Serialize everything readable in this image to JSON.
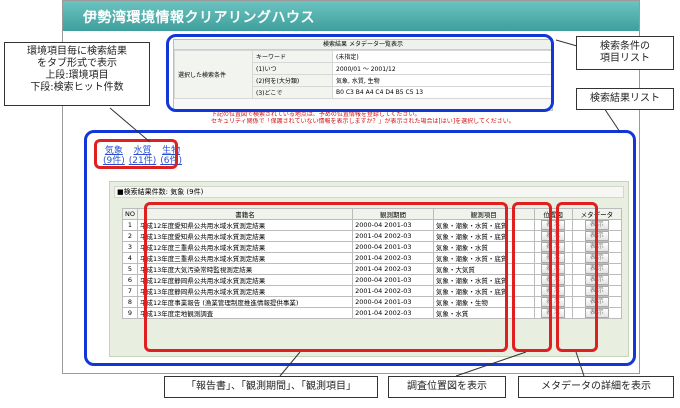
{
  "site": {
    "title": "伊勢湾環境情報クリアリングハウス"
  },
  "conditions": {
    "title": "検索結果 メタデータ一覧表示",
    "group_label": "選択した検索条件",
    "rows": [
      {
        "label": "キーワード",
        "value": "(未指定)"
      },
      {
        "label": "(1)いつ",
        "value": "2000/01 〜 2001/12"
      },
      {
        "label": "(2)何を(大分類)",
        "value": "気象, 水質, 生物"
      },
      {
        "label": "(3)どこで",
        "value": "B0 C3 B4 A4 C4 D4 B5 C5 13"
      }
    ]
  },
  "notice": {
    "line1": "下記の位置図で検索されている地点は、予めの位置情報を登録してください。",
    "line2": "セキュリティ関係で「保護されていない情報を表示しますか？」が表示された場合は[はい]を選択してください。"
  },
  "tabs": [
    {
      "label": "気象",
      "count": "(9件)"
    },
    {
      "label": "水質",
      "count": "(21件)"
    },
    {
      "label": "生物",
      "count": "(6件)"
    }
  ],
  "results": {
    "summary": "■検索結果件数: 気象 (9件)",
    "columns": [
      "NO",
      "書籍名",
      "観測期間",
      "観測項目",
      "位置図",
      "メタデータ"
    ],
    "button_label": "表 示",
    "rows": [
      {
        "no": "1",
        "name": "平成12年度愛知県公共用水域水質測定結果",
        "period": "2000-04 2001-03",
        "items": "気象・潮象・水質・底質"
      },
      {
        "no": "2",
        "name": "平成13年度愛知県公共用水域水質測定結果",
        "period": "2001-04 2002-03",
        "items": "気象・潮象・水質・底質"
      },
      {
        "no": "3",
        "name": "平成12年度三重県公共用水域水質測定結果",
        "period": "2000-04 2001-03",
        "items": "気象・潮象・水質"
      },
      {
        "no": "4",
        "name": "平成13年度三重県公共用水域水質測定結果",
        "period": "2001-04 2002-03",
        "items": "気象・潮象・水質・底質"
      },
      {
        "no": "5",
        "name": "平成13年度大気汚染常時監視測定結果",
        "period": "2001-04 2002-03",
        "items": "気象・大気質"
      },
      {
        "no": "6",
        "name": "平成12年度静岡県公共用水域水質測定結果",
        "period": "2000-04 2001-03",
        "items": "気象・潮象・水質・底質"
      },
      {
        "no": "7",
        "name": "平成13年度静岡県公共用水域水質測定結果",
        "period": "2001-04 2002-03",
        "items": "気象・潮象・水質・底質"
      },
      {
        "no": "8",
        "name": "平成12年度事業報告 (漁業管理制度推進情報提供事業)",
        "period": "2000-04 2001-03",
        "items": "気象・潮象・生物"
      },
      {
        "no": "9",
        "name": "平成13年度定地観測調査",
        "period": "2001-04 2002-03",
        "items": "気象・水質"
      }
    ]
  },
  "callouts": {
    "tab_note_1": "環境項目毎に検索結果",
    "tab_note_2": "をタブ形式で表示",
    "tab_note_3": "上段:環境項目",
    "tab_note_4": "下段:検索ヒット件数",
    "conditions_note_1": "検索条件の",
    "conditions_note_2": "項目リスト",
    "results_note": "検索結果リスト",
    "columns_note": "「報告書」、「観測期間」、「観測項目」",
    "location_note": "調査位置図を表示",
    "metadata_note": "メタデータの詳細を表示"
  },
  "colors": {
    "highlight_blue": "#1236d8",
    "highlight_red": "#e02020",
    "header": "#3e9f9c"
  }
}
